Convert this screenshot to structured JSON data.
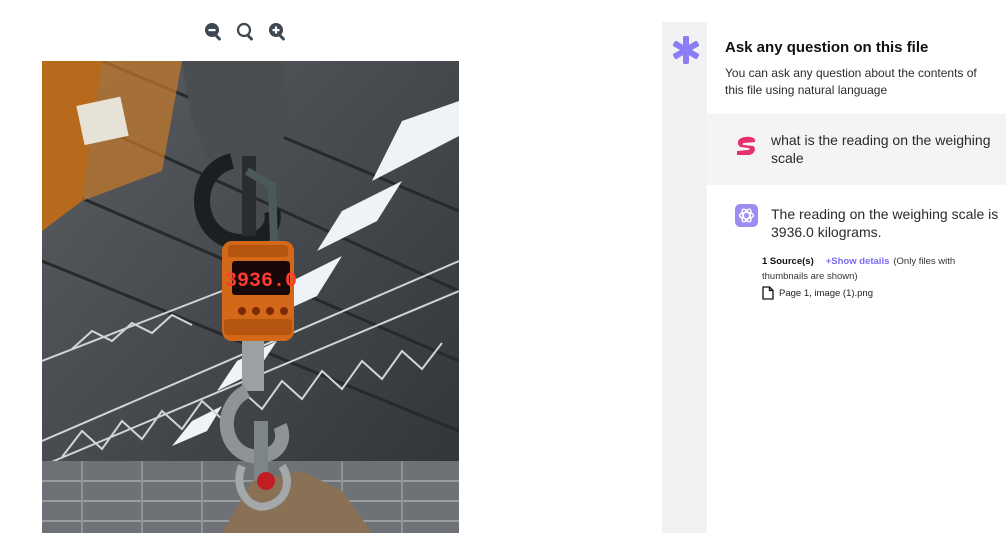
{
  "toolbar": {
    "icons": [
      "zoom-out-icon",
      "zoom-reset-icon",
      "zoom-in-icon"
    ]
  },
  "viewer": {
    "display": {
      "digits": "3936.0"
    }
  },
  "chat": {
    "header": {
      "title": "Ask any question on this file",
      "subtitle": "You can ask any question about the contents of this file using natural language"
    },
    "messages": [
      {
        "role": "user",
        "text": "what is the reading on the weighing scale"
      },
      {
        "role": "assistant",
        "text": "The reading on the weighing scale is 3936.0 kilograms."
      }
    ],
    "sources": {
      "count_label": "1 Source(s)",
      "details_label": "+Show details",
      "note": "(Only files with thumbnails are shown)",
      "items": [
        {
          "label": "Page 1, image (1).png"
        }
      ]
    }
  },
  "colors": {
    "accent": "#7a6cf0",
    "star": "#8b7df3",
    "gutter": "#f2f2f4",
    "question_bg": "#f4f3f5"
  }
}
